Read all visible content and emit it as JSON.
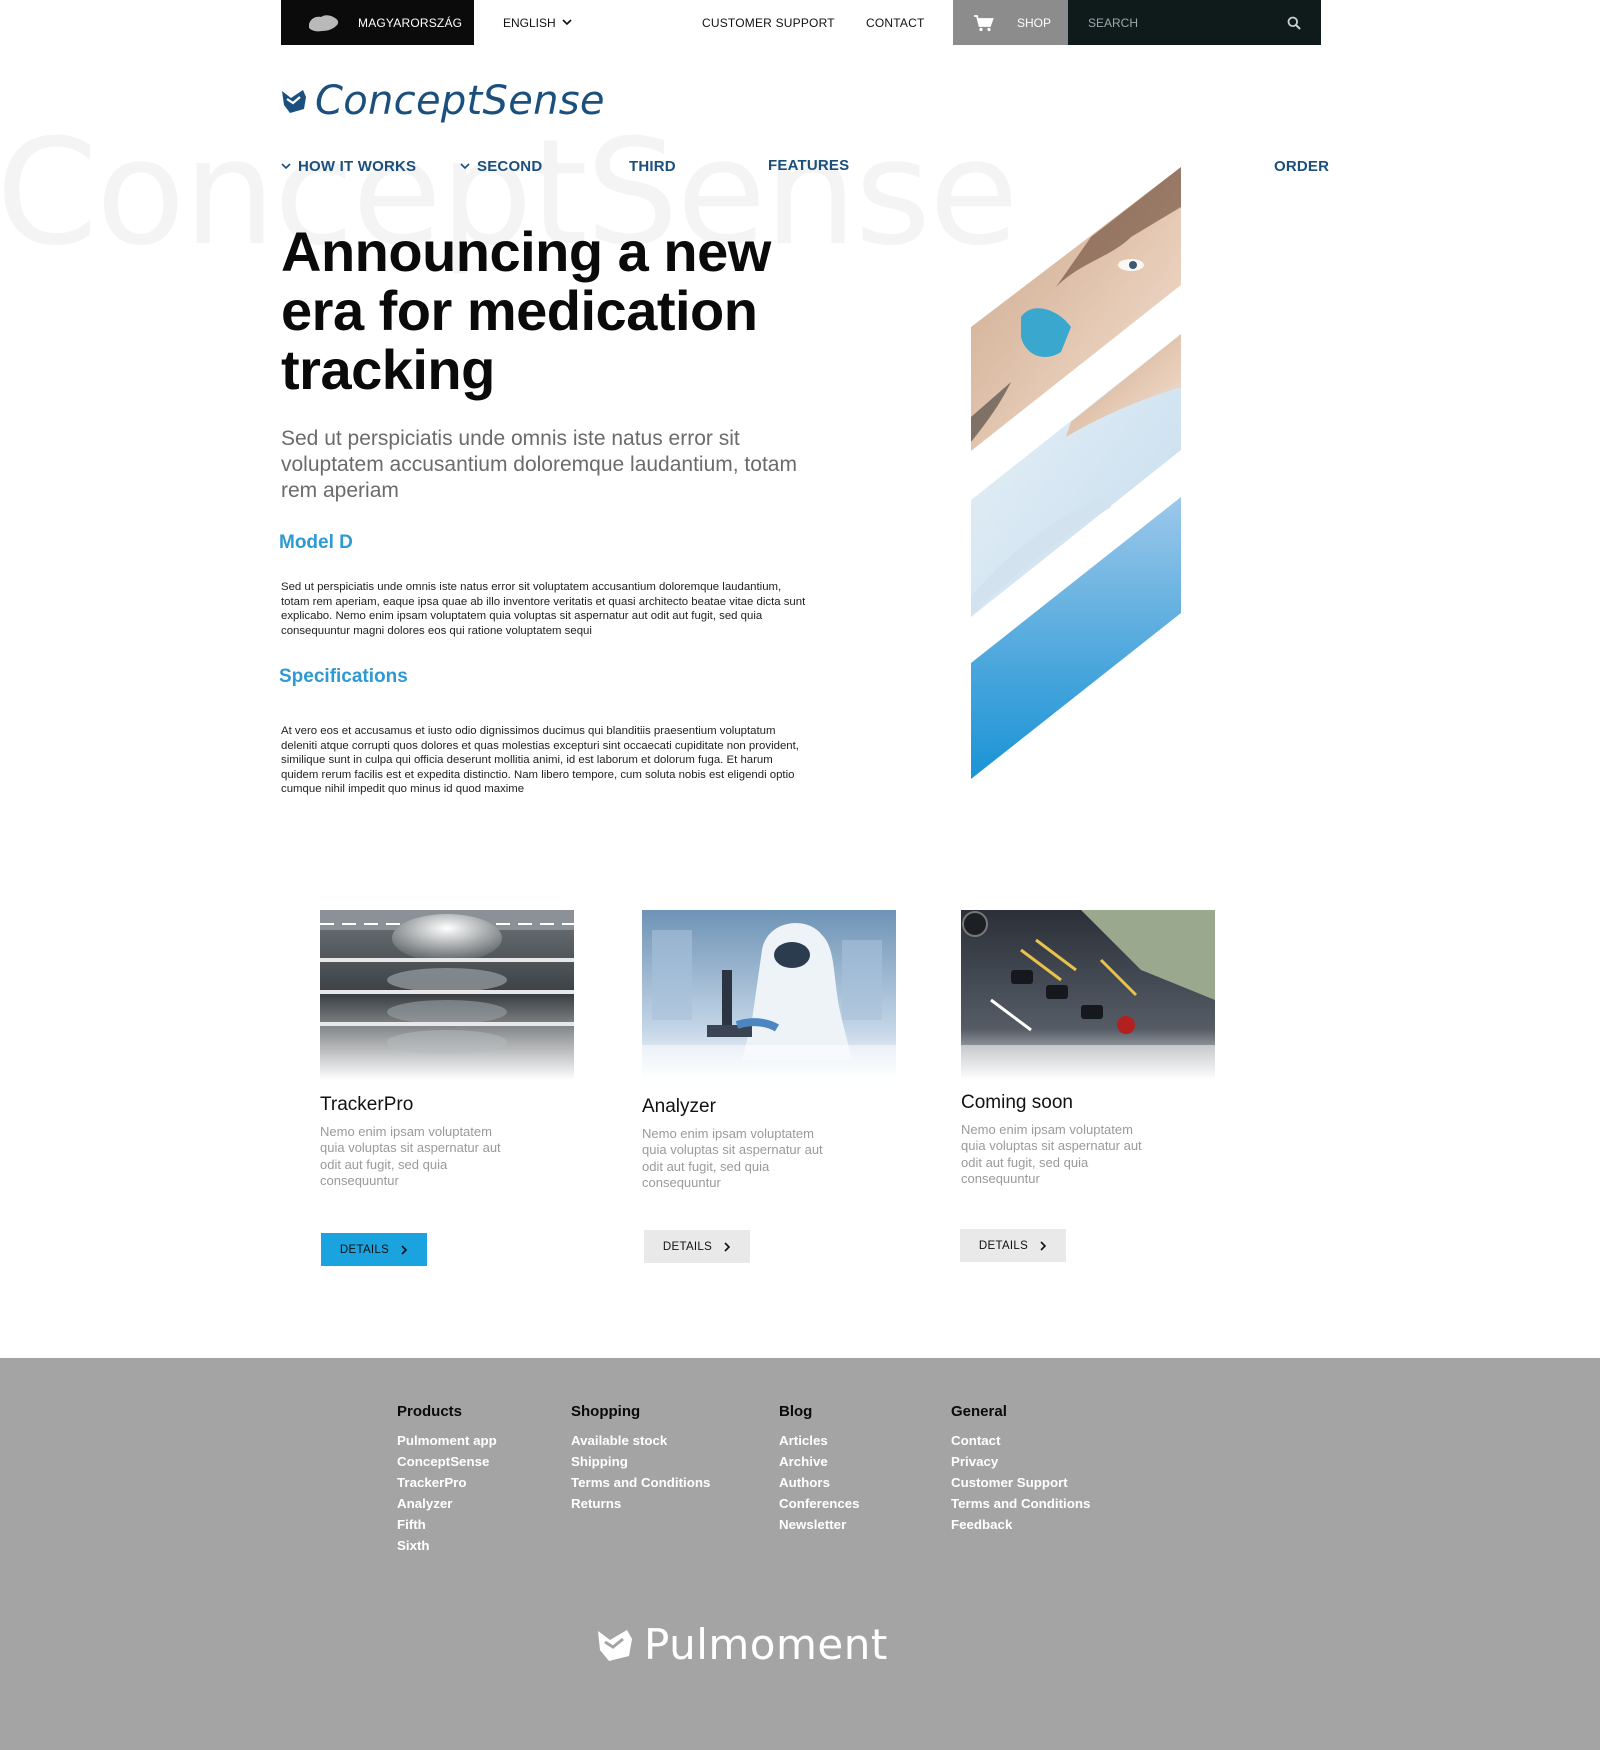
{
  "topbar": {
    "region_label": "MAGYARORSZÁG",
    "language_label": "ENGLISH",
    "customer_support_label": "CUSTOMER SUPPORT",
    "contact_label": "CONTACT",
    "shop_label": "SHOP",
    "search_placeholder": "SEARCH"
  },
  "brand": {
    "name": "ConceptSense",
    "watermark": "ConceptSense"
  },
  "nav": {
    "how_it_works": "HOW IT WORKS",
    "second": "SECOND",
    "third": "THIRD",
    "features": "FEATURES",
    "order": "ORDER"
  },
  "hero": {
    "headline": "Announcing a new era for medication tracking",
    "lead": "Sed ut perspiciatis unde omnis iste natus error sit voluptatem accusantium doloremque laudantium, totam rem aperiam",
    "model_heading": "Model D",
    "model_text": "Sed ut perspiciatis unde omnis iste natus error sit voluptatem accusantium doloremque laudantium, totam rem aperiam, eaque ipsa quae ab illo inventore veritatis et quasi architecto beatae vitae dicta sunt explicabo. Nemo enim ipsam voluptatem quia voluptas sit aspernatur aut odit aut fugit, sed quia consequuntur magni dolores eos qui ratione voluptatem sequi",
    "spec_heading": "Specifications",
    "spec_text": "At vero eos et accusamus et iusto odio dignissimos ducimus qui blanditiis praesentium voluptatum deleniti atque corrupti quos dolores et quas molestias excepturi sint occaecati cupiditate non provident, similique sunt in culpa qui officia deserunt mollitia animi, id est laborum et dolorum fuga. Et harum quidem rerum facilis est et expedita distinctio. Nam libero tempore, cum soluta nobis est eligendi optio cumque nihil impedit quo minus id quod maxime"
  },
  "cards": [
    {
      "title": "TrackerPro",
      "desc": "Nemo enim ipsam voluptatem quia voluptas sit aspernatur aut odit aut fugit, sed quia consequuntur",
      "button": "DETAILS",
      "button_color": "#1ba3e0"
    },
    {
      "title": "Analyzer",
      "desc": "Nemo enim ipsam voluptatem quia voluptas sit aspernatur aut odit aut fugit, sed quia consequuntur",
      "button": "DETAILS",
      "button_color": "#e9e9e9"
    },
    {
      "title": "Coming soon",
      "desc": "Nemo enim ipsam voluptatem quia voluptas sit aspernatur aut odit aut fugit, sed quia consequuntur",
      "button": "DETAILS",
      "button_color": "#e9e9e9"
    }
  ],
  "footer": {
    "columns": [
      {
        "heading": "Products",
        "links": [
          "Pulmoment app",
          "ConceptSense",
          "TrackerPro",
          "Analyzer",
          "Fifth",
          "Sixth"
        ]
      },
      {
        "heading": "Shopping",
        "links": [
          "Available stock",
          "Shipping",
          "Terms and Conditions",
          "Returns"
        ]
      },
      {
        "heading": "Blog",
        "links": [
          "Articles",
          "Archive",
          "Authors",
          "Conferences",
          "Newsletter"
        ]
      },
      {
        "heading": "General",
        "links": [
          "Contact",
          "Privacy",
          "Customer Support",
          "Terms and Conditions",
          "Feedback"
        ]
      }
    ],
    "brand": "Pulmoment"
  },
  "colors": {
    "brand_blue": "#1b4f7d",
    "accent_blue": "#2e9ad3",
    "footer_bg": "#a4a4a4"
  }
}
